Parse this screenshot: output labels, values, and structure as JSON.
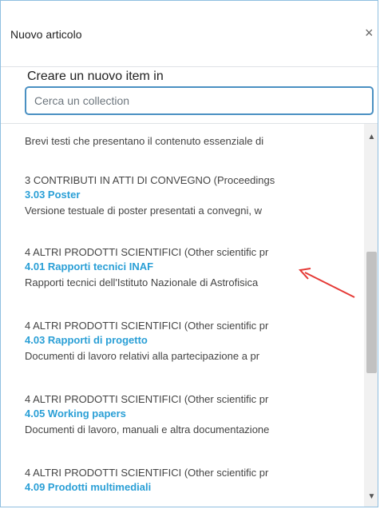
{
  "dialog": {
    "title": "Nuovo articolo",
    "close": "×"
  },
  "subtitle": "Creare un nuovo item in",
  "search": {
    "placeholder": "Cerca un collection",
    "value": ""
  },
  "list": {
    "top_description": "Brevi testi che presentano il contenuto essenziale di",
    "items": [
      {
        "parent": "3 CONTRIBUTI IN ATTI DI CONVEGNO (Proceedings",
        "collection": "3.03 Poster",
        "description": "Versione testuale di poster presentati a convegni, w"
      },
      {
        "parent": "4 ALTRI PRODOTTI SCIENTIFICI (Other scientific pr",
        "collection": "4.01 Rapporti tecnici INAF",
        "description": "Rapporti tecnici dell'Istituto Nazionale di Astrofisica"
      },
      {
        "parent": "4 ALTRI PRODOTTI SCIENTIFICI (Other scientific pr",
        "collection": "4.03 Rapporti di progetto",
        "description": "Documenti di lavoro relativi alla partecipazione a pr"
      },
      {
        "parent": "4 ALTRI PRODOTTI SCIENTIFICI (Other scientific pr",
        "collection": "4.05 Working papers",
        "description": "Documenti di lavoro, manuali e altra documentazione"
      },
      {
        "parent": "4 ALTRI PRODOTTI SCIENTIFICI (Other scientific pr",
        "collection": "4.09 Prodotti multimediali",
        "description": ""
      }
    ]
  },
  "scrollbar": {
    "up_icon": "triangle-up",
    "down_icon": "triangle-down"
  },
  "annotation": {
    "color": "#e53935"
  },
  "colors": {
    "accent": "#2a9fd6",
    "border": "#4a90c2"
  }
}
